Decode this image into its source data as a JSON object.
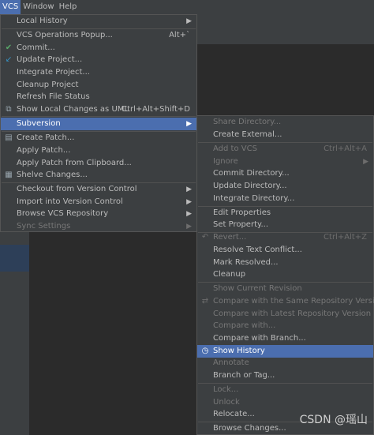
{
  "menubar": {
    "items": [
      "VCS",
      "Window",
      "Help"
    ]
  },
  "vcs_menu": {
    "local_history": "Local History",
    "vcs_operations_popup": "VCS Operations Popup...",
    "vcs_operations_popup_shortcut": "Alt+`",
    "commit": "Commit...",
    "update_project": "Update Project...",
    "integrate_project": "Integrate Project...",
    "cleanup_project": "Cleanup Project",
    "refresh_file_status": "Refresh File Status",
    "show_local_changes_uml": "Show Local Changes as UML",
    "show_local_changes_uml_shortcut": "Ctrl+Alt+Shift+D",
    "subversion": "Subversion",
    "create_patch": "Create Patch...",
    "apply_patch": "Apply Patch...",
    "apply_patch_clipboard": "Apply Patch from Clipboard...",
    "shelve_changes": "Shelve Changes...",
    "checkout": "Checkout from Version Control",
    "import": "Import into Version Control",
    "browse_vcs_repository": "Browse VCS Repository",
    "sync_settings": "Sync Settings"
  },
  "subversion_menu": {
    "share_directory": "Share Directory...",
    "create_external": "Create External...",
    "add_to_vcs": "Add to VCS",
    "add_to_vcs_shortcut": "Ctrl+Alt+A",
    "ignore": "Ignore",
    "commit_directory": "Commit Directory...",
    "update_directory": "Update Directory...",
    "integrate_directory": "Integrate Directory...",
    "edit_properties": "Edit Properties",
    "set_property": "Set Property...",
    "revert": "Revert...",
    "revert_shortcut": "Ctrl+Alt+Z",
    "resolve_text_conflict": "Resolve Text Conflict...",
    "mark_resolved": "Mark Resolved...",
    "cleanup": "Cleanup",
    "show_current_revision": "Show Current Revision",
    "compare_same_repo_version": "Compare with the Same Repository Version",
    "compare_latest_repo_version": "Compare with Latest Repository Version",
    "compare_with": "Compare with...",
    "compare_with_branch": "Compare with Branch...",
    "show_history": "Show History",
    "annotate": "Annotate",
    "branch_or_tag": "Branch or Tag...",
    "lock": "Lock...",
    "unlock": "Unlock",
    "relocate": "Relocate...",
    "browse_changes": "Browse Changes..."
  },
  "watermark": "CSDN @瑶山",
  "colors": {
    "menu_bg": "#3c3f41",
    "highlight": "#4b6eaf",
    "disabled_text": "#777777"
  },
  "icons": [
    "check-icon",
    "update-arrow-icon",
    "uml-icon",
    "patch-icon",
    "shelve-icon",
    "revert-icon",
    "clock-icon",
    "compare-icon"
  ]
}
